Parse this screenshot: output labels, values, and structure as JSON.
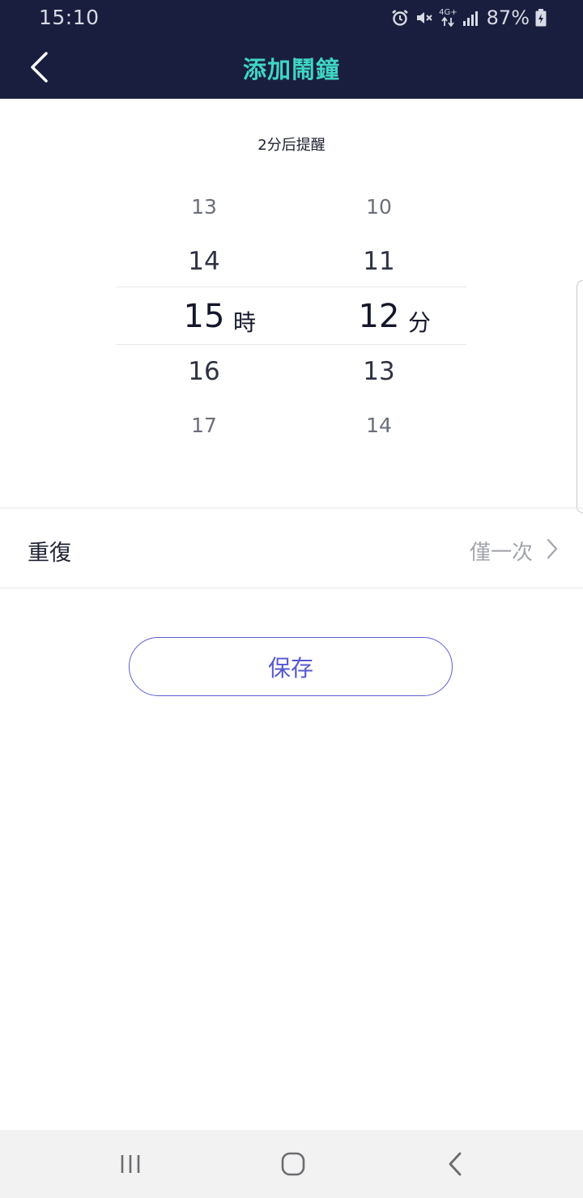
{
  "status_bar": {
    "time": "15:10",
    "network": "4G+",
    "battery": "87%",
    "icons": [
      "alarm-icon",
      "mute-icon",
      "network-4g-icon",
      "signal-icon",
      "battery-charging-icon"
    ]
  },
  "header": {
    "title": "添加鬧鐘",
    "back_icon": "chevron-left-icon",
    "background": "#1a1e3e",
    "title_color": "#3fd6c4"
  },
  "hint": "2分后提醒",
  "time_picker": {
    "hour_unit": "時",
    "minute_unit": "分",
    "hours": [
      "13",
      "14",
      "15",
      "16",
      "17"
    ],
    "minutes": [
      "10",
      "11",
      "12",
      "13",
      "14"
    ],
    "selected_hour": "15",
    "selected_minute": "12"
  },
  "repeat": {
    "label": "重復",
    "value": "僅一次"
  },
  "save_button": {
    "label": "保存",
    "color": "#5457d3"
  },
  "nav_bar": {
    "icons": [
      "recent-apps-icon",
      "home-icon",
      "back-nav-icon"
    ]
  }
}
